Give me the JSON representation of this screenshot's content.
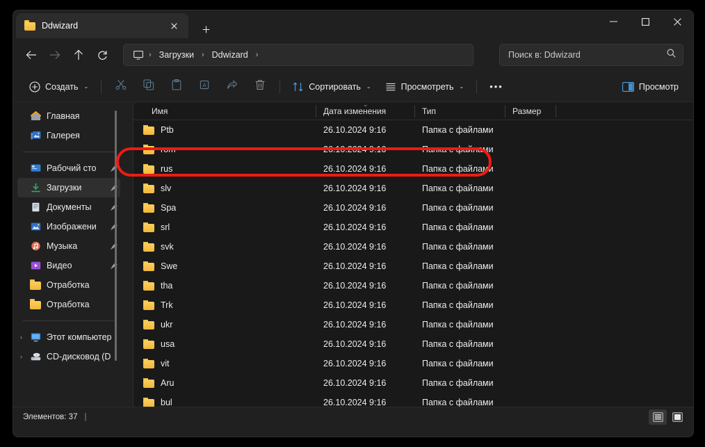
{
  "window": {
    "tab_title": "Ddwizard",
    "tab_close": "✕",
    "tab_new": "+",
    "minimize": "—",
    "maximize": "□",
    "close": "✕"
  },
  "nav": {
    "back": "←",
    "forward": "→",
    "up": "↑",
    "refresh": "⟳",
    "breadcrumbs": [
      {
        "label": "",
        "icon": "monitor-icon"
      },
      {
        "label": "Загрузки",
        "icon": ""
      },
      {
        "label": "Ddwizard",
        "icon": ""
      }
    ],
    "separator": "›"
  },
  "search": {
    "placeholder": "Поиск в: Ddwizard",
    "value": "",
    "icon": "search-icon"
  },
  "toolbar": {
    "new_label": "Создать",
    "cut_icon": "scissors-icon",
    "copy_icon": "copy-icon",
    "paste_icon": "paste-icon",
    "rename_icon": "rename-icon",
    "share_icon": "share-icon",
    "delete_icon": "trash-icon",
    "sort_label": "Сортировать",
    "view_label": "Просмотреть",
    "more_label": "•••",
    "preview_label": "Просмотр",
    "chevron": "⌄"
  },
  "sidebar": {
    "items": [
      {
        "label": "Главная",
        "icon": "home-icon",
        "pinned": false,
        "selected": false,
        "arrow": false
      },
      {
        "label": "Галерея",
        "icon": "gallery-icon",
        "pinned": false,
        "selected": false,
        "arrow": false
      },
      {
        "label": "Рабочий сто",
        "icon": "desktop-icon",
        "pinned": true,
        "selected": false,
        "arrow": false
      },
      {
        "label": "Загрузки",
        "icon": "downloads-icon",
        "pinned": true,
        "selected": true,
        "arrow": false
      },
      {
        "label": "Документы",
        "icon": "documents-icon",
        "pinned": true,
        "selected": false,
        "arrow": false
      },
      {
        "label": "Изображени",
        "icon": "pictures-icon",
        "pinned": true,
        "selected": false,
        "arrow": false
      },
      {
        "label": "Музыка",
        "icon": "music-icon",
        "pinned": true,
        "selected": false,
        "arrow": false
      },
      {
        "label": "Видео",
        "icon": "video-icon",
        "pinned": true,
        "selected": false,
        "arrow": false
      },
      {
        "label": "Отработка",
        "icon": "folder-icon",
        "pinned": false,
        "selected": false,
        "arrow": false
      },
      {
        "label": "Отработка",
        "icon": "folder-icon",
        "pinned": false,
        "selected": false,
        "arrow": false
      },
      {
        "label": "Этот компьютер",
        "icon": "pc-icon",
        "pinned": false,
        "selected": false,
        "arrow": true
      },
      {
        "label": "CD-дисковод (D",
        "icon": "cd-icon",
        "pinned": false,
        "selected": false,
        "arrow": true
      }
    ],
    "arrow_glyph": "›"
  },
  "columns": {
    "name": "Имя",
    "date": "Дата изменения",
    "type": "Тип",
    "size": "Размер",
    "sort_indicator": "⌄"
  },
  "files": [
    {
      "name": "Ptb",
      "date": "26.10.2024 9:16",
      "type": "Папка с файлами",
      "size": ""
    },
    {
      "name": "rom",
      "date": "26.10.2024 9:16",
      "type": "Папка с файлами",
      "size": ""
    },
    {
      "name": "rus",
      "date": "26.10.2024 9:16",
      "type": "Папка с файлами",
      "size": ""
    },
    {
      "name": "slv",
      "date": "26.10.2024 9:16",
      "type": "Папка с файлами",
      "size": ""
    },
    {
      "name": "Spa",
      "date": "26.10.2024 9:16",
      "type": "Папка с файлами",
      "size": ""
    },
    {
      "name": "srl",
      "date": "26.10.2024 9:16",
      "type": "Папка с файлами",
      "size": ""
    },
    {
      "name": "svk",
      "date": "26.10.2024 9:16",
      "type": "Папка с файлами",
      "size": ""
    },
    {
      "name": "Swe",
      "date": "26.10.2024 9:16",
      "type": "Папка с файлами",
      "size": ""
    },
    {
      "name": "tha",
      "date": "26.10.2024 9:16",
      "type": "Папка с файлами",
      "size": ""
    },
    {
      "name": "Trk",
      "date": "26.10.2024 9:16",
      "type": "Папка с файлами",
      "size": ""
    },
    {
      "name": "ukr",
      "date": "26.10.2024 9:16",
      "type": "Папка с файлами",
      "size": ""
    },
    {
      "name": "usa",
      "date": "26.10.2024 9:16",
      "type": "Папка с файлами",
      "size": ""
    },
    {
      "name": "vit",
      "date": "26.10.2024 9:16",
      "type": "Папка с файлами",
      "size": ""
    },
    {
      "name": "Aru",
      "date": "26.10.2024 9:16",
      "type": "Папка с файлами",
      "size": ""
    },
    {
      "name": "bul",
      "date": "26.10.2024 9:16",
      "type": "Папка с файлами",
      "size": ""
    }
  ],
  "status": {
    "items_label": "Элементов: 37",
    "separator": "|",
    "list_view_icon": "list-view-icon",
    "tiles_view_icon": "tiles-view-icon"
  },
  "annotation": {
    "color": "#ef1b13",
    "target_row": "rus"
  }
}
